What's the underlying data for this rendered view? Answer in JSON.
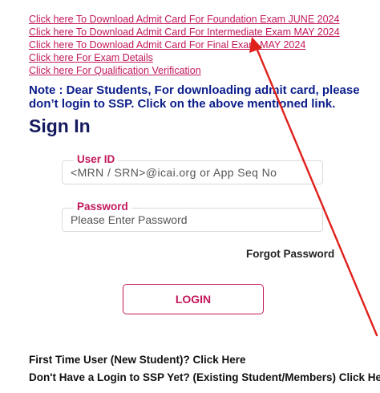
{
  "links": [
    "Click here To Download Admit Card For Foundation Exam JUNE 2024",
    "Click here To Download Admit Card For Intermediate Exam MAY 2024",
    "Click here To Download Admit Card For Final Exam MAY 2024",
    "Click here For Exam Details",
    "Click here For Qualification Verification"
  ],
  "note": "Note : Dear Students, For downloading admit card, please don’t login to SSP. Click on the above mentioned link.",
  "signin": {
    "title": "Sign In",
    "user_label": "User ID",
    "user_placeholder": "<MRN / SRN>@icai.org or App Seq No",
    "password_label": "Password",
    "password_placeholder": "Please Enter Password",
    "forgot": "Forgot Password",
    "login_button": "LOGIN"
  },
  "footer": {
    "first_time": "First Time User (New Student)? Click Here",
    "no_login": "Don't Have a Login to SSP Yet? (Existing Student/Members) Click Here"
  },
  "colors": {
    "link": "#c2185b",
    "note": "#0b1d8a",
    "title": "#151a5e",
    "annotation_arrow": "#e0201b"
  }
}
